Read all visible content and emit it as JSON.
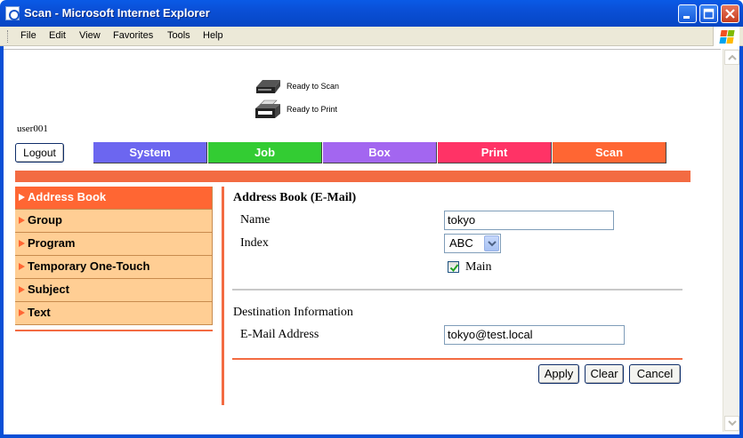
{
  "window": {
    "title": "Scan - Microsoft Internet Explorer"
  },
  "menubar": {
    "items": [
      "File",
      "Edit",
      "View",
      "Favorites",
      "Tools",
      "Help"
    ]
  },
  "status": {
    "scan": "Ready to Scan",
    "print": "Ready to Print"
  },
  "user": {
    "name": "user001",
    "logout_label": "Logout"
  },
  "tabs": [
    {
      "label": "System",
      "color": "#6c66f0"
    },
    {
      "label": "Job",
      "color": "#33cc33"
    },
    {
      "label": "Box",
      "color": "#a366f0"
    },
    {
      "label": "Print",
      "color": "#ff3366"
    },
    {
      "label": "Scan",
      "color": "#ff6633"
    }
  ],
  "sidebar": {
    "items": [
      {
        "label": "Address Book",
        "active": true
      },
      {
        "label": "Group"
      },
      {
        "label": "Program"
      },
      {
        "label": "Temporary One-Touch"
      },
      {
        "label": "Subject"
      },
      {
        "label": "Text"
      }
    ]
  },
  "form": {
    "title": "Address Book (E-Mail)",
    "name_label": "Name",
    "name_value": "tokyo",
    "index_label": "Index",
    "index_value": "ABC",
    "main_label": "Main",
    "main_checked": true,
    "dest_title": "Destination Information",
    "email_label": "E-Mail Address",
    "email_value": "tokyo@test.local"
  },
  "actions": {
    "apply": "Apply",
    "clear": "Clear",
    "cancel": "Cancel"
  },
  "colors": {
    "accent": "#f36b42",
    "sidebar_bg": "#ffce94",
    "sidebar_active": "#ff6633"
  }
}
